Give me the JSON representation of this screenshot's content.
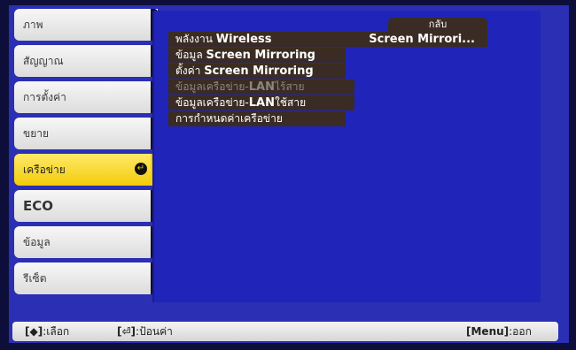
{
  "sidebar": {
    "items": [
      {
        "label": "ภาพ"
      },
      {
        "label": "สัญญาณ"
      },
      {
        "label": "การตั้งค่า"
      },
      {
        "label": "ขยาย"
      },
      {
        "label": "เครือข่าย",
        "active": true
      },
      {
        "label": "ECO"
      },
      {
        "label": "ข้อมูล"
      },
      {
        "label": "รีเซ็ต"
      }
    ]
  },
  "panel": {
    "back_label": "กลับ",
    "items": [
      {
        "prefix": "พลังงาน ",
        "bold": "Wireless",
        "value": "Screen Mirrori..."
      },
      {
        "prefix": "ข้อมูล ",
        "bold": "Screen Mirroring",
        "value": ""
      },
      {
        "prefix": "ตั้งค่า ",
        "bold": "Screen Mirroring",
        "value": ""
      },
      {
        "prefix": "ข้อมูลเครือข่าย-",
        "bold": "LAN",
        "suffix": "ไร้สาย",
        "disabled": true
      },
      {
        "prefix": "ข้อมูลเครือข่าย-",
        "bold": "LAN",
        "suffix": "ใช้สาย"
      },
      {
        "prefix": "การกำหนดค่าเครือข่าย",
        "bold": "",
        "suffix": ""
      }
    ]
  },
  "footer": {
    "select_key": "[◆]",
    "select_label": ":เลือก",
    "enter_key": "[⏎]",
    "enter_label": ":ป้อนค่า",
    "exit_key": "[Menu]",
    "exit_label": ":ออก"
  },
  "colors": {
    "background": "#2b2fb4",
    "active_item": "#f2cc08",
    "submenu_bar": "#3a2c24"
  }
}
